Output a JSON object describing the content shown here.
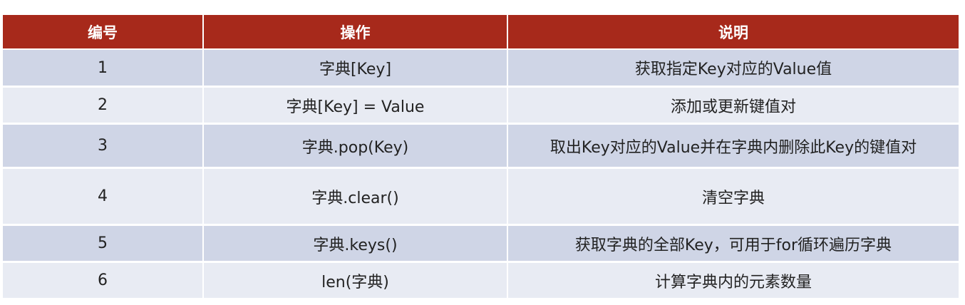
{
  "table": {
    "headers": [
      "编号",
      "操作",
      "说明"
    ],
    "rows": [
      [
        "1",
        "字典[Key]",
        "获取指定Key对应的Value值"
      ],
      [
        "2",
        "字典[Key] = Value",
        "添加或更新键值对"
      ],
      [
        "3",
        "字典.pop(Key)",
        "取出Key对应的Value并在字典内删除此Key的键值对"
      ],
      [
        "4",
        "字典.clear()",
        "清空字典"
      ],
      [
        "5",
        "字典.keys()",
        "获取字典的全部Key，可用于for循环遍历字典"
      ],
      [
        "6",
        "len(字典)",
        "计算字典内的元素数量"
      ]
    ]
  },
  "colors": {
    "header_bg": "#a7291b",
    "header_text": "#ffffff",
    "row_odd_bg": "#cfd5e6",
    "row_even_bg": "#e8ebf3",
    "cell_text": "#222222"
  }
}
